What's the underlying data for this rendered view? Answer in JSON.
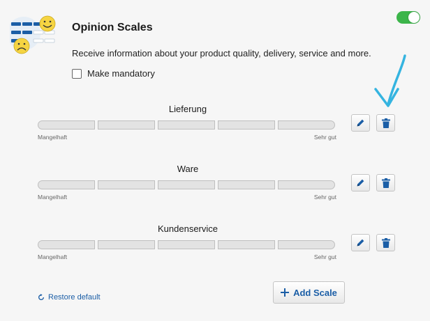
{
  "header": {
    "title": "Opinion Scales",
    "description": "Receive information about your product quality, delivery, service and more.",
    "mandatory_label": "Make mandatory",
    "mandatory_checked": false,
    "enabled": true
  },
  "scales": [
    {
      "name": "Lieferung",
      "low_label": "Mangelhaft",
      "high_label": "Sehr gut"
    },
    {
      "name": "Ware",
      "low_label": "Mangelhaft",
      "high_label": "Sehr gut"
    },
    {
      "name": "Kundenservice",
      "low_label": "Mangelhaft",
      "high_label": "Sehr gut"
    }
  ],
  "footer": {
    "restore_label": "Restore default",
    "add_label": "Add Scale"
  },
  "icons": [
    "opinion-scales-logo-icon",
    "pencil-icon",
    "trash-icon",
    "restore-icon",
    "plus-icon",
    "annotation-arrow-icon"
  ],
  "colors": {
    "accent": "#1b5ea6",
    "toggle_on": "#3cb54a",
    "annotation": "#35b4e0"
  }
}
